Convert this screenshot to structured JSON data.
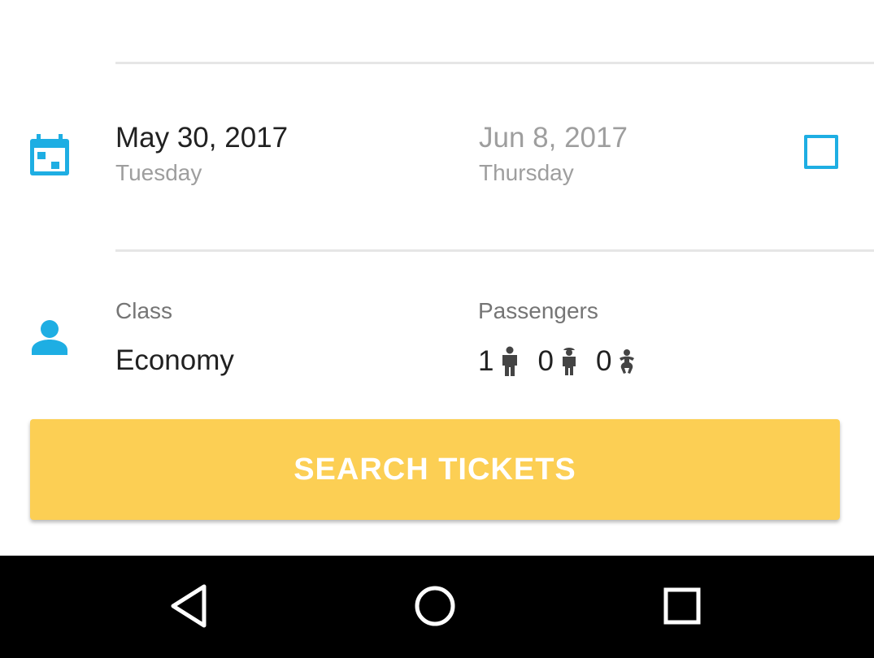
{
  "dates": {
    "depart": {
      "date": "May 30, 2017",
      "weekday": "Tuesday"
    },
    "return": {
      "date": "Jun 8, 2017",
      "weekday": "Thursday",
      "enabled": false
    }
  },
  "trip": {
    "class_label": "Class",
    "class_value": "Economy",
    "passengers_label": "Passengers",
    "adults": "1",
    "children": "0",
    "infants": "0"
  },
  "search_button": {
    "label": "SEARCH TICKETS"
  },
  "colors": {
    "accent": "#1eaee3",
    "button": "#fccf54",
    "nav_bar": "#000000"
  },
  "icons": {
    "date": "calendar-icon",
    "travellers": "person-icon",
    "adult": "adult-icon",
    "child": "child-icon",
    "infant": "infant-icon",
    "back": "back-icon",
    "home": "home-icon",
    "recents": "recents-icon"
  }
}
